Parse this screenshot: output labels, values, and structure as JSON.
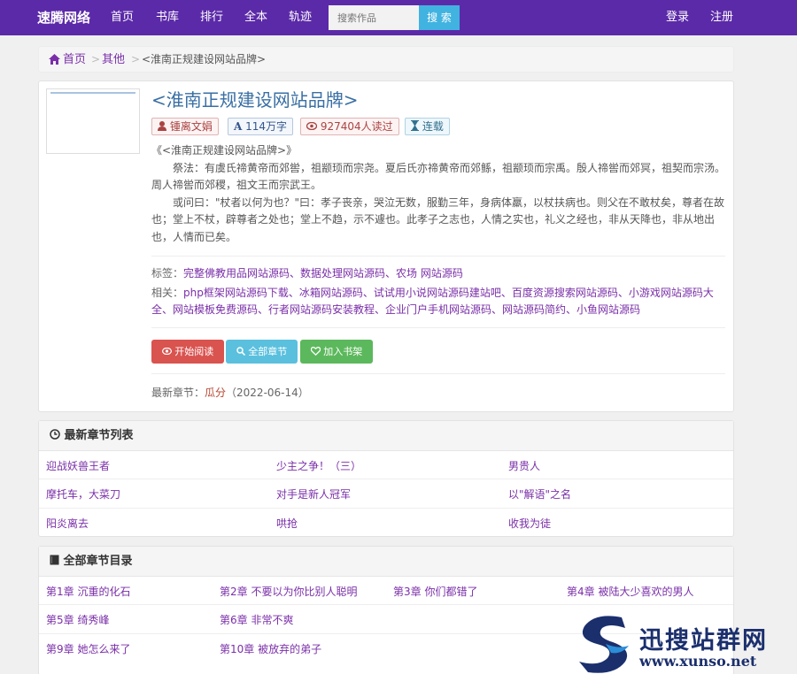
{
  "navbar": {
    "brand": "速腾网络",
    "links": [
      "首页",
      "书库",
      "排行",
      "全本",
      "轨迹"
    ],
    "search_placeholder": "搜索作品",
    "search_button": "搜 索",
    "login": "登录",
    "register": "注册"
  },
  "breadcrumb": {
    "home": "首页",
    "category": "其他",
    "current": "<淮南正规建设网站品牌>",
    "separator": ">"
  },
  "book": {
    "title": "<淮南正规建设网站品牌>",
    "author": "锺离文娟",
    "words": "114万字",
    "reads": "927404人读过",
    "status": "连载",
    "desc_title": "《<淮南正规建设网站品牌>》",
    "desc_p1": "祭法：有虞氏禘黄帝而郊喾，祖颛顼而宗尧。夏后氏亦禘黄帝而郊鲧，祖颛顼而宗禹。殷人禘喾而郊冥，祖契而宗汤。周人禘喾而郊稷，祖文王而宗武王。",
    "desc_p2": "或问曰：\"杖者以何为也？\"曰：孝子丧亲，哭泣无数，服勤三年，身病体羸，以杖扶病也。则父在不敢杖矣，尊者在故也；堂上不杖，辟尊者之处也；堂上不趋，示不遽也。此孝子之志也，人情之实也，礼义之经也，非从天降也，非从地出也，人情而已矣。",
    "tags_label": "标签：",
    "tags": "完整佛教用品网站源码、数据处理网站源码、农场 网站源码",
    "related_label": "相关：",
    "related": "php框架网站源码下载、冰箱网站源码、试试用小说网站源码建站吧、百度资源搜索网站源码、小游戏网站源码大全、网站模板免费源码、行者网站源码安装教程、企业门户手机网站源码、网站源码简约、小鱼网站源码",
    "btn_read": "开始阅读",
    "btn_all": "全部章节",
    "btn_shelf": "加入书架",
    "latest_label": "最新章节：",
    "latest_chapter": "瓜分",
    "latest_date": "（2022-06-14）"
  },
  "latest_list": {
    "heading": "最新章节列表",
    "items": [
      "迎战妖兽王者",
      "少主之争！（三）",
      "男贵人",
      "摩托车，大菜刀",
      "对手是新人冠军",
      "以\"解语\"之名",
      "阳炎离去",
      "哄抢",
      "收我为徒"
    ]
  },
  "all_list": {
    "heading": "全部章节目录",
    "items": [
      "第1章 沉重的化石",
      "第2章 不要以为你比别人聪明",
      "第3章 你们都错了",
      "第4章 被陆大少喜欢的男人",
      "第5章 绮秀峰",
      "第6章 非常不爽",
      "第9章 她怎么来了",
      "第10章 被放弃的弟子"
    ]
  },
  "watermark": {
    "text": "迅搜站群网",
    "url": "www.xunso.net"
  },
  "colors": {
    "navbar": "#5b2aa8",
    "link": "#7a2fa8",
    "search_button": "#41b3e0",
    "btn_read": "#d9534f",
    "btn_all": "#5bc0de",
    "btn_shelf": "#5cb85c"
  }
}
